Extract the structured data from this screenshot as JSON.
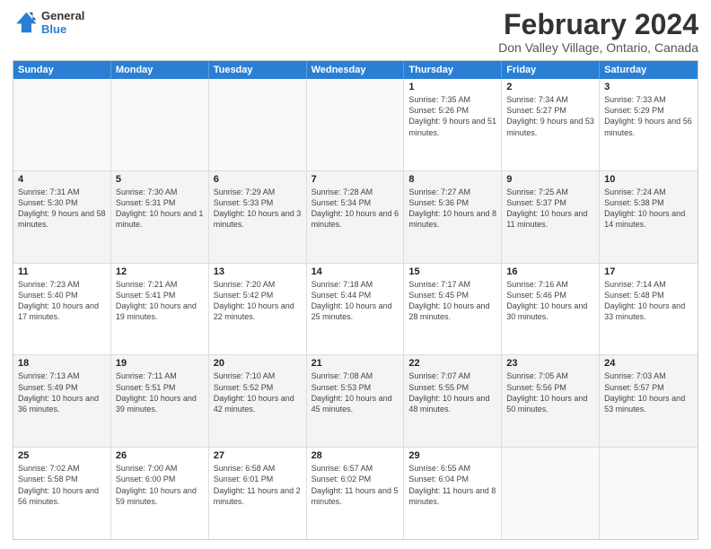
{
  "logo": {
    "line1": "General",
    "line2": "Blue"
  },
  "title": "February 2024",
  "subtitle": "Don Valley Village, Ontario, Canada",
  "days_of_week": [
    "Sunday",
    "Monday",
    "Tuesday",
    "Wednesday",
    "Thursday",
    "Friday",
    "Saturday"
  ],
  "weeks": [
    [
      {
        "day": "",
        "info": ""
      },
      {
        "day": "",
        "info": ""
      },
      {
        "day": "",
        "info": ""
      },
      {
        "day": "",
        "info": ""
      },
      {
        "day": "1",
        "info": "Sunrise: 7:35 AM\nSunset: 5:26 PM\nDaylight: 9 hours and 51 minutes."
      },
      {
        "day": "2",
        "info": "Sunrise: 7:34 AM\nSunset: 5:27 PM\nDaylight: 9 hours and 53 minutes."
      },
      {
        "day": "3",
        "info": "Sunrise: 7:33 AM\nSunset: 5:29 PM\nDaylight: 9 hours and 56 minutes."
      }
    ],
    [
      {
        "day": "4",
        "info": "Sunrise: 7:31 AM\nSunset: 5:30 PM\nDaylight: 9 hours and 58 minutes."
      },
      {
        "day": "5",
        "info": "Sunrise: 7:30 AM\nSunset: 5:31 PM\nDaylight: 10 hours and 1 minute."
      },
      {
        "day": "6",
        "info": "Sunrise: 7:29 AM\nSunset: 5:33 PM\nDaylight: 10 hours and 3 minutes."
      },
      {
        "day": "7",
        "info": "Sunrise: 7:28 AM\nSunset: 5:34 PM\nDaylight: 10 hours and 6 minutes."
      },
      {
        "day": "8",
        "info": "Sunrise: 7:27 AM\nSunset: 5:36 PM\nDaylight: 10 hours and 8 minutes."
      },
      {
        "day": "9",
        "info": "Sunrise: 7:25 AM\nSunset: 5:37 PM\nDaylight: 10 hours and 11 minutes."
      },
      {
        "day": "10",
        "info": "Sunrise: 7:24 AM\nSunset: 5:38 PM\nDaylight: 10 hours and 14 minutes."
      }
    ],
    [
      {
        "day": "11",
        "info": "Sunrise: 7:23 AM\nSunset: 5:40 PM\nDaylight: 10 hours and 17 minutes."
      },
      {
        "day": "12",
        "info": "Sunrise: 7:21 AM\nSunset: 5:41 PM\nDaylight: 10 hours and 19 minutes."
      },
      {
        "day": "13",
        "info": "Sunrise: 7:20 AM\nSunset: 5:42 PM\nDaylight: 10 hours and 22 minutes."
      },
      {
        "day": "14",
        "info": "Sunrise: 7:18 AM\nSunset: 5:44 PM\nDaylight: 10 hours and 25 minutes."
      },
      {
        "day": "15",
        "info": "Sunrise: 7:17 AM\nSunset: 5:45 PM\nDaylight: 10 hours and 28 minutes."
      },
      {
        "day": "16",
        "info": "Sunrise: 7:16 AM\nSunset: 5:46 PM\nDaylight: 10 hours and 30 minutes."
      },
      {
        "day": "17",
        "info": "Sunrise: 7:14 AM\nSunset: 5:48 PM\nDaylight: 10 hours and 33 minutes."
      }
    ],
    [
      {
        "day": "18",
        "info": "Sunrise: 7:13 AM\nSunset: 5:49 PM\nDaylight: 10 hours and 36 minutes."
      },
      {
        "day": "19",
        "info": "Sunrise: 7:11 AM\nSunset: 5:51 PM\nDaylight: 10 hours and 39 minutes."
      },
      {
        "day": "20",
        "info": "Sunrise: 7:10 AM\nSunset: 5:52 PM\nDaylight: 10 hours and 42 minutes."
      },
      {
        "day": "21",
        "info": "Sunrise: 7:08 AM\nSunset: 5:53 PM\nDaylight: 10 hours and 45 minutes."
      },
      {
        "day": "22",
        "info": "Sunrise: 7:07 AM\nSunset: 5:55 PM\nDaylight: 10 hours and 48 minutes."
      },
      {
        "day": "23",
        "info": "Sunrise: 7:05 AM\nSunset: 5:56 PM\nDaylight: 10 hours and 50 minutes."
      },
      {
        "day": "24",
        "info": "Sunrise: 7:03 AM\nSunset: 5:57 PM\nDaylight: 10 hours and 53 minutes."
      }
    ],
    [
      {
        "day": "25",
        "info": "Sunrise: 7:02 AM\nSunset: 5:58 PM\nDaylight: 10 hours and 56 minutes."
      },
      {
        "day": "26",
        "info": "Sunrise: 7:00 AM\nSunset: 6:00 PM\nDaylight: 10 hours and 59 minutes."
      },
      {
        "day": "27",
        "info": "Sunrise: 6:58 AM\nSunset: 6:01 PM\nDaylight: 11 hours and 2 minutes."
      },
      {
        "day": "28",
        "info": "Sunrise: 6:57 AM\nSunset: 6:02 PM\nDaylight: 11 hours and 5 minutes."
      },
      {
        "day": "29",
        "info": "Sunrise: 6:55 AM\nSunset: 6:04 PM\nDaylight: 11 hours and 8 minutes."
      },
      {
        "day": "",
        "info": ""
      },
      {
        "day": "",
        "info": ""
      }
    ]
  ]
}
